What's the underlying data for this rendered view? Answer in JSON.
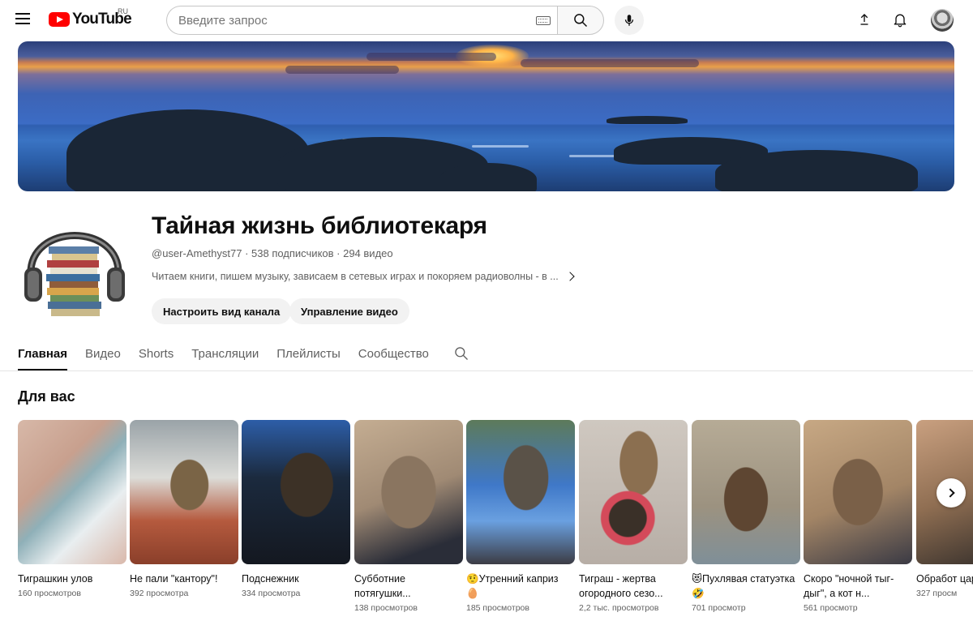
{
  "header": {
    "logo_text": "YouTube",
    "region": "RU",
    "search_placeholder": "Введите запрос"
  },
  "channel": {
    "title": "Тайная жизнь библиотекаря",
    "meta": "@user-Amethyst77 · 538 подписчиков · 294 видео",
    "description": "Читаем книги, пишем музыку, зависаем в сетевых играх и покоряем радиоволны - в ...",
    "buttons": {
      "customize": "Настроить вид канала",
      "manage": "Управление видео"
    }
  },
  "tabs": [
    {
      "label": "Главная",
      "active": true
    },
    {
      "label": "Видео",
      "active": false
    },
    {
      "label": "Shorts",
      "active": false
    },
    {
      "label": "Трансляции",
      "active": false
    },
    {
      "label": "Плейлисты",
      "active": false
    },
    {
      "label": "Сообщество",
      "active": false
    }
  ],
  "section": {
    "title": "Для вас",
    "shorts": [
      {
        "title": "Тиграшкин улов",
        "views": "160 просмотров"
      },
      {
        "title": "Не пали \"кантору\"!",
        "views": "392 просмотра"
      },
      {
        "title": "Подснежник",
        "views": "334 просмотра"
      },
      {
        "title": "Субботние потягушки...",
        "views": "138 просмотров"
      },
      {
        "title": "🤨Утренний каприз🥚",
        "views": "185 просмотров"
      },
      {
        "title": "Тиграш - жертва огородного сезо...",
        "views": "2,2 тыс. просмотров"
      },
      {
        "title": "😻Пухлявая статуэтка 🤣",
        "views": "701 просмотр"
      },
      {
        "title": "Скоро \"ночной тыг-дыг\", а кот н...",
        "views": "561 просмотр"
      },
      {
        "title": "Обработ царапин",
        "views": "327 просм"
      }
    ]
  }
}
